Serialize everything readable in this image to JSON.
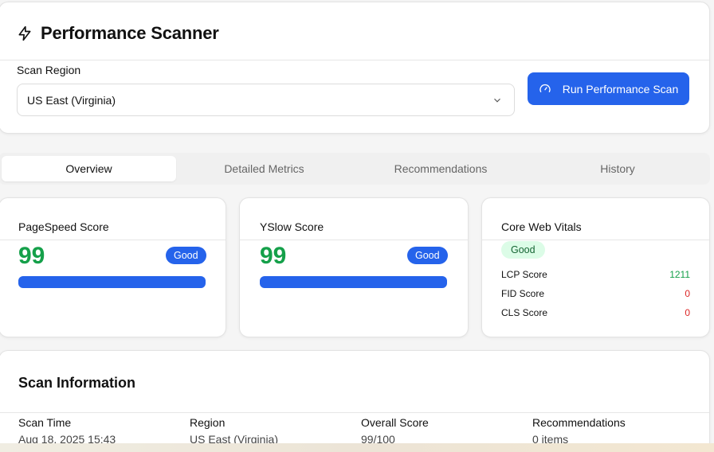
{
  "header": {
    "title": "Performance Scanner",
    "icon": "bolt-icon"
  },
  "scan_region": {
    "label": "Scan Region",
    "selected": "US East (Virginia)"
  },
  "run_button": {
    "label": "Run Performance Scan",
    "icon": "gauge-icon"
  },
  "tabs": [
    {
      "label": "Overview",
      "active": true
    },
    {
      "label": "Detailed Metrics",
      "active": false
    },
    {
      "label": "Recommendations",
      "active": false
    },
    {
      "label": "History",
      "active": false
    }
  ],
  "pagespeed": {
    "title": "PageSpeed Score",
    "score": "99",
    "badge": "Good",
    "progress": 0.99
  },
  "yslow": {
    "title": "YSlow Score",
    "score": "99",
    "badge": "Good",
    "progress": 0.99
  },
  "core_web_vitals": {
    "title": "Core Web Vitals",
    "badge": "Good",
    "rows": [
      {
        "label": "LCP Score",
        "value": "1211",
        "status": "good"
      },
      {
        "label": "FID Score",
        "value": "0",
        "status": "bad"
      },
      {
        "label": "CLS Score",
        "value": "0",
        "status": "bad"
      }
    ]
  },
  "scan_info": {
    "title": "Scan Information",
    "fields": [
      {
        "label": "Scan Time",
        "value": "Aug 18, 2025 15:43"
      },
      {
        "label": "Region",
        "value": "US East (Virginia)"
      },
      {
        "label": "Overall Score",
        "value": "99/100"
      },
      {
        "label": "Recommendations",
        "value": "0 items"
      }
    ]
  },
  "colors": {
    "accent": "#2563eb",
    "good": "#15a04a",
    "bad": "#dc2626",
    "badge_good_bg": "#dcfce7"
  }
}
